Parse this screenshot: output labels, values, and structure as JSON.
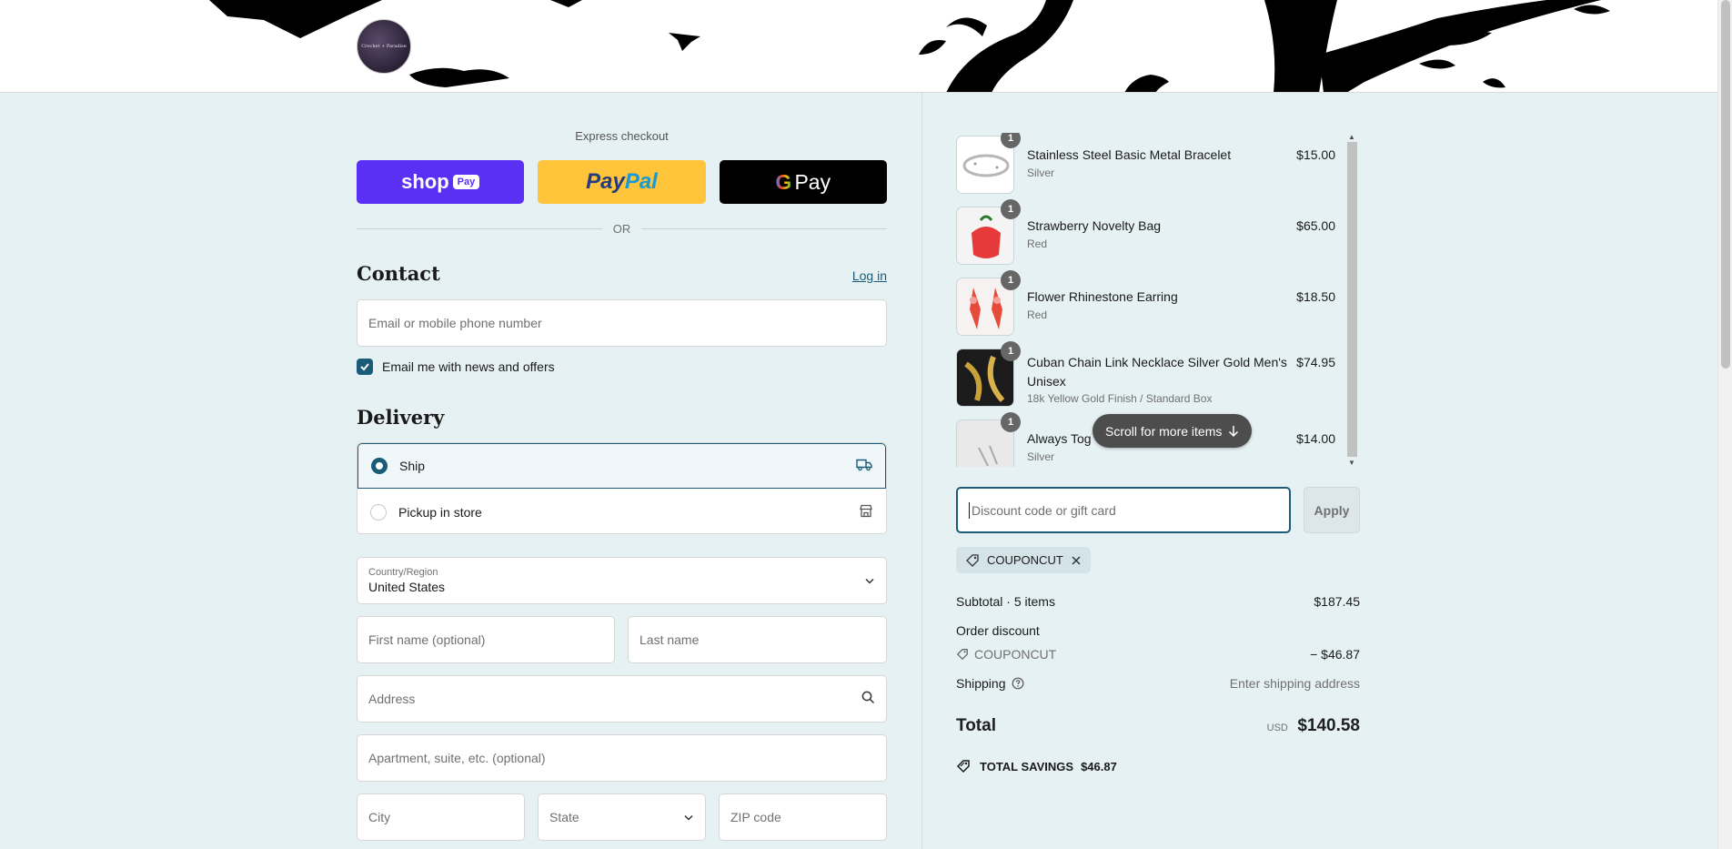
{
  "header": {
    "logo_text": "Crochet + Paradise"
  },
  "express": {
    "title": "Express checkout",
    "shop_pay": {
      "word": "shop",
      "pill": "Pay"
    },
    "paypal": {
      "part1": "Pay",
      "part2": "Pal"
    },
    "gpay": {
      "g": "G",
      "word": "Pay"
    },
    "or_label": "OR"
  },
  "contact": {
    "title": "Contact",
    "login_label": "Log in",
    "email_placeholder": "Email or mobile phone number",
    "newsletter_label": "Email me with news and offers",
    "newsletter_checked": true
  },
  "delivery": {
    "title": "Delivery",
    "options": [
      {
        "label": "Ship",
        "selected": true
      },
      {
        "label": "Pickup in store",
        "selected": false
      }
    ],
    "country_label": "Country/Region",
    "country_value": "United States",
    "first_name": "First name (optional)",
    "last_name": "Last name",
    "address": "Address",
    "apartment": "Apartment, suite, etc. (optional)",
    "city": "City",
    "state": "State",
    "zip": "ZIP code"
  },
  "cart": {
    "items": [
      {
        "qty": "1",
        "name": "Stainless Steel Basic Metal Bracelet",
        "variant": "Silver",
        "price": "$15.00"
      },
      {
        "qty": "1",
        "name": "Strawberry Novelty Bag",
        "variant": "Red",
        "price": "$65.00"
      },
      {
        "qty": "1",
        "name": "Flower Rhinestone Earring",
        "variant": "Red",
        "price": "$18.50"
      },
      {
        "qty": "1",
        "name": "Cuban Chain Link Necklace Silver Gold Men's Unisex",
        "variant": "18k Yellow Gold Finish / Standard Box",
        "price": "$74.95"
      },
      {
        "qty": "1",
        "name": "Always Tog",
        "variant": "Silver",
        "price": "$14.00"
      }
    ],
    "scroll_more": "Scroll for more items"
  },
  "discount": {
    "placeholder": "Discount code or gift card",
    "apply": "Apply",
    "applied_code": "COUPONCUT"
  },
  "summary": {
    "subtotal_label": "Subtotal · 5 items",
    "subtotal_value": "$187.45",
    "order_discount_label": "Order discount",
    "discount_code": "COUPONCUT",
    "discount_value": "− $46.87",
    "shipping_label": "Shipping",
    "shipping_value": "Enter shipping address",
    "total_label": "Total",
    "currency": "USD",
    "total_value": "$140.58",
    "savings_label": "TOTAL SAVINGS",
    "savings_value": "$46.87"
  },
  "colors": {
    "accent": "#1a5b78",
    "shop_pay": "#5a31f4",
    "paypal": "#ffc439",
    "background": "#e6f1f3"
  }
}
